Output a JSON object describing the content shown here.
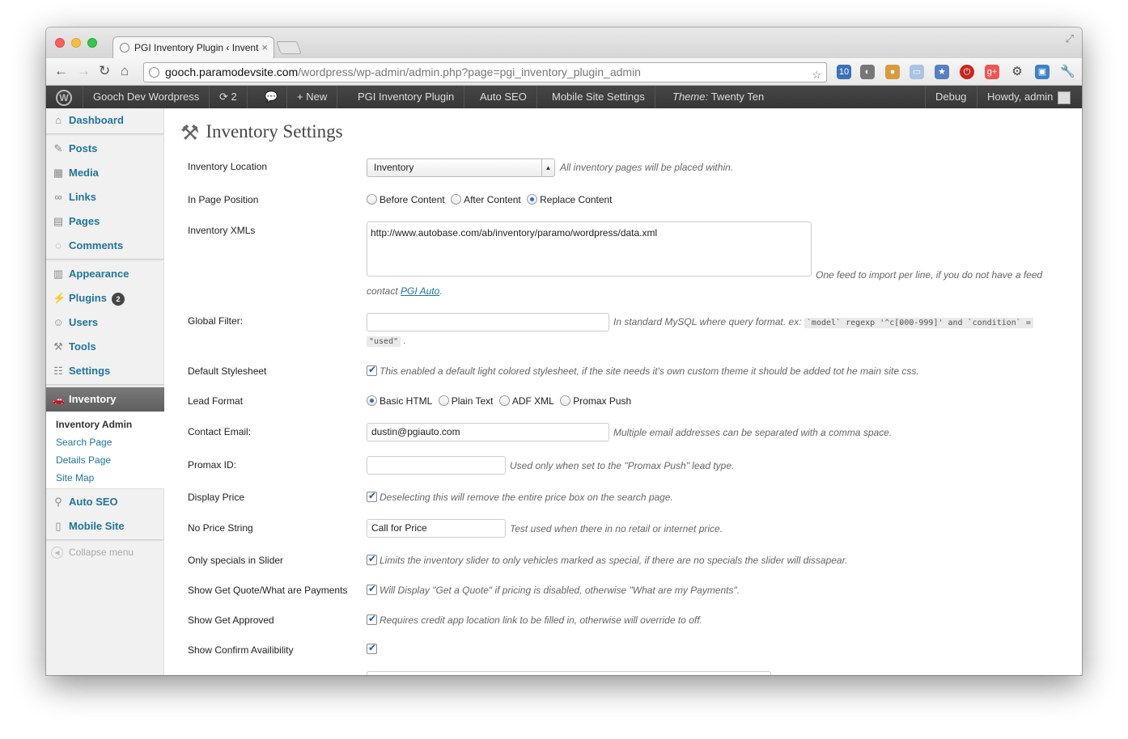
{
  "browser": {
    "tab_title": "PGI Inventory Plugin ‹ Invent",
    "tab_close": "×",
    "url_host": "gooch.paramodevsite.com",
    "url_path": "/wordpress/wp-admin/admin.php?page=pgi_inventory_plugin_admin",
    "ext_badge": "10"
  },
  "adminbar": {
    "site_name": "Gooch Dev Wordpress",
    "updates": "2",
    "new_label": "New",
    "plugin": "PGI Inventory Plugin",
    "auto_seo": "Auto SEO",
    "mobile": "Mobile Site Settings",
    "theme_prefix": "Theme:",
    "theme_name": "Twenty Ten",
    "debug": "Debug",
    "howdy": "Howdy, admin"
  },
  "sidebar": {
    "items": [
      {
        "label": "Dashboard"
      },
      {
        "label": "Posts"
      },
      {
        "label": "Media"
      },
      {
        "label": "Links"
      },
      {
        "label": "Pages"
      },
      {
        "label": "Comments"
      },
      {
        "label": "Appearance"
      },
      {
        "label": "Plugins",
        "badge": "2"
      },
      {
        "label": "Users"
      },
      {
        "label": "Tools"
      },
      {
        "label": "Settings"
      }
    ],
    "current": "Inventory",
    "submenu": [
      "Inventory Admin",
      "Search Page",
      "Details Page",
      "Site Map"
    ],
    "auto_seo": "Auto SEO",
    "mobile_site": "Mobile Site",
    "collapse": "Collapse menu"
  },
  "page": {
    "title": "Inventory Settings",
    "fields": {
      "inventory_location": {
        "label": "Inventory Location",
        "value": "Inventory",
        "desc": "All inventory pages will be placed within."
      },
      "in_page_position": {
        "label": "In Page Position",
        "options": [
          "Before Content",
          "After Content",
          "Replace Content"
        ],
        "selected": "Replace Content"
      },
      "inventory_xmls": {
        "label": "Inventory XMLs",
        "value": "http://www.autobase.com/ab/inventory/paramo/wordpress/data.xml",
        "desc": "One feed to import per line, if you do not have a feed",
        "desc2": "contact",
        "link": "PGI Auto",
        "after_link": "."
      },
      "global_filter": {
        "label": "Global Filter:",
        "value": "",
        "desc": "In standard MySQL where query format. ex:",
        "code1": "`model` regexp '^c[000-999]' and `condition` =",
        "code2": "\"used\"",
        "after_code": "."
      },
      "default_stylesheet": {
        "label": "Default Stylesheet",
        "checked": true,
        "desc": "This enabled a default light colored stylesheet, if the site needs it's own custom theme it should be added tot he main site css."
      },
      "lead_format": {
        "label": "Lead Format",
        "options": [
          "Basic HTML",
          "Plain Text",
          "ADF XML",
          "Promax Push"
        ],
        "selected": "Basic HTML"
      },
      "contact_email": {
        "label": "Contact Email:",
        "value": "dustin@pgiauto.com",
        "desc": "Multiple email addresses can be separated with a comma space."
      },
      "promax_id": {
        "label": "Promax ID:",
        "value": "",
        "desc": "Used only when set to the \"Promax Push\" lead type."
      },
      "display_price": {
        "label": "Display Price",
        "checked": true,
        "desc": "Deselecting this will remove the entire price box on the search page."
      },
      "no_price_string": {
        "label": "No Price String",
        "value": "Call for Price",
        "desc": "Test used when there in no retail or internet price."
      },
      "only_specials": {
        "label": "Only specials in Slider",
        "checked": true,
        "desc": "Limits the inventory slider to only vehicles marked as special, if there are no specials the slider will dissapear."
      },
      "get_quote": {
        "label": "Show Get Quote/What are Payments",
        "checked": true,
        "desc": "Will Display \"Get a Quote\" if pricing is disabled, otherwise \"What are my Payments\"."
      },
      "get_approved": {
        "label": "Show Get Approved",
        "checked": true,
        "desc": "Requires credit app location link to be filled in, otherwise will override to off."
      },
      "confirm_availability": {
        "label": "Show Confirm Availibility",
        "checked": true
      }
    }
  }
}
